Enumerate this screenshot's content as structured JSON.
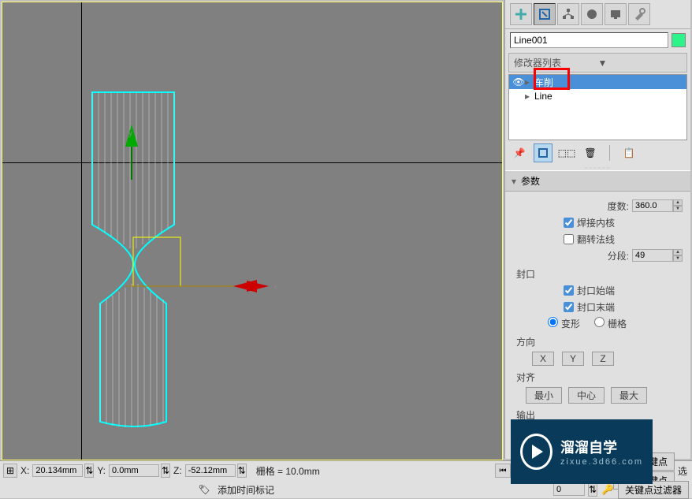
{
  "object_name": "Line001",
  "modifier_dropdown": "修改器列表",
  "modifier_stack": [
    {
      "label": "车削",
      "selected": true,
      "eye": true
    },
    {
      "label": "Line",
      "selected": false,
      "expandable": true
    }
  ],
  "rollout_params_title": "参数",
  "params": {
    "degrees_label": "度数:",
    "degrees_value": "360.0",
    "weld_core": "焊接内核",
    "flip_normals": "翻转法线",
    "segments_label": "分段:",
    "segments_value": "49",
    "cap_heading": "封口",
    "cap_start": "封口始端",
    "cap_end": "封口末端",
    "cap_morph": "变形",
    "cap_grid": "栅格",
    "direction_heading": "方向",
    "axis_x": "X",
    "axis_y": "Y",
    "axis_z": "Z",
    "align_heading": "对齐",
    "align_min": "最小",
    "align_center": "中心",
    "align_max": "最大",
    "output_heading": "输出"
  },
  "status": {
    "x_label": "X:",
    "x_value": "20.134mm",
    "y_label": "Y:",
    "y_value": "0.0mm",
    "z_label": "Z:",
    "z_value": "-52.12mm",
    "grid_label": "栅格 = 10.0mm",
    "add_time_tag": "添加时间标记",
    "auto_key": "自动关键点",
    "set_key": "设置关键点",
    "sel_label_cut": "选",
    "key_filter": "关键点过滤器",
    "frame_value": "0"
  },
  "watermark": {
    "line1": "溜溜自学",
    "line2": "zixue.3d66.com"
  }
}
